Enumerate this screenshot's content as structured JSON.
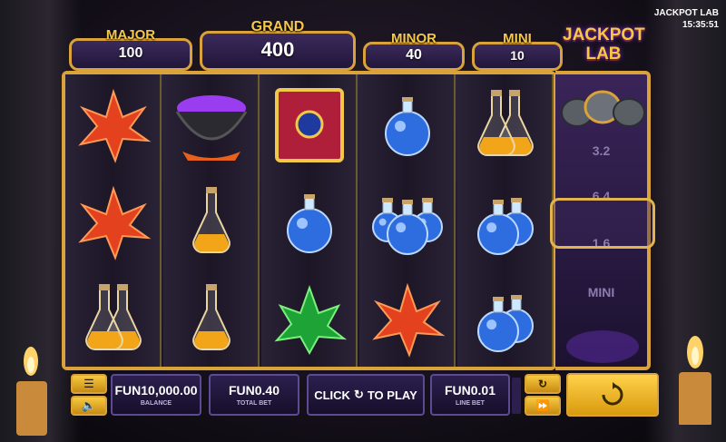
{
  "top_info": {
    "game_name": "JACKPOT LAB",
    "clock": "15:35:51"
  },
  "logo": {
    "line1": "JACKPOT",
    "line2": "LAB"
  },
  "jackpots": {
    "major": {
      "label": "MAJOR",
      "value": "100"
    },
    "grand": {
      "label": "GRAND",
      "value": "400"
    },
    "minor": {
      "label": "MINOR",
      "value": "40"
    },
    "mini": {
      "label": "MINI",
      "value": "10"
    }
  },
  "side_meter": {
    "multipliers": [
      "3.2",
      "6.4",
      "1.6"
    ],
    "mini_label": "MINI"
  },
  "reels": [
    [
      "red-crystal",
      "red-crystal",
      "yellow-flasks"
    ],
    [
      "purple-cauldron",
      "yellow-flask",
      "yellow-flask"
    ],
    [
      "spell-book",
      "blue-potion",
      "green-crystal"
    ],
    [
      "blue-potion",
      "blue-potions-triple",
      "red-crystal"
    ],
    [
      "yellow-flasks",
      "blue-potions",
      "blue-potions"
    ]
  ],
  "bottom_bar": {
    "balance": {
      "value": "FUN10,000.00",
      "label": "BALANCE"
    },
    "total_bet": {
      "value": "FUN0.40",
      "label": "TOTAL BET"
    },
    "click_to_play": {
      "prefix": "CLICK",
      "suffix": "TO PLAY"
    },
    "line_bet": {
      "value": "FUN0.01",
      "label": "LINE BET"
    }
  },
  "colors": {
    "gold": "#d9a23a",
    "panel_purple": "#2c1f4e",
    "jackpot_yellow": "#f5c84a"
  },
  "icons": [
    "menu-icon",
    "sound-icon",
    "refresh-icon",
    "fast-forward-icon",
    "spin-icon"
  ]
}
